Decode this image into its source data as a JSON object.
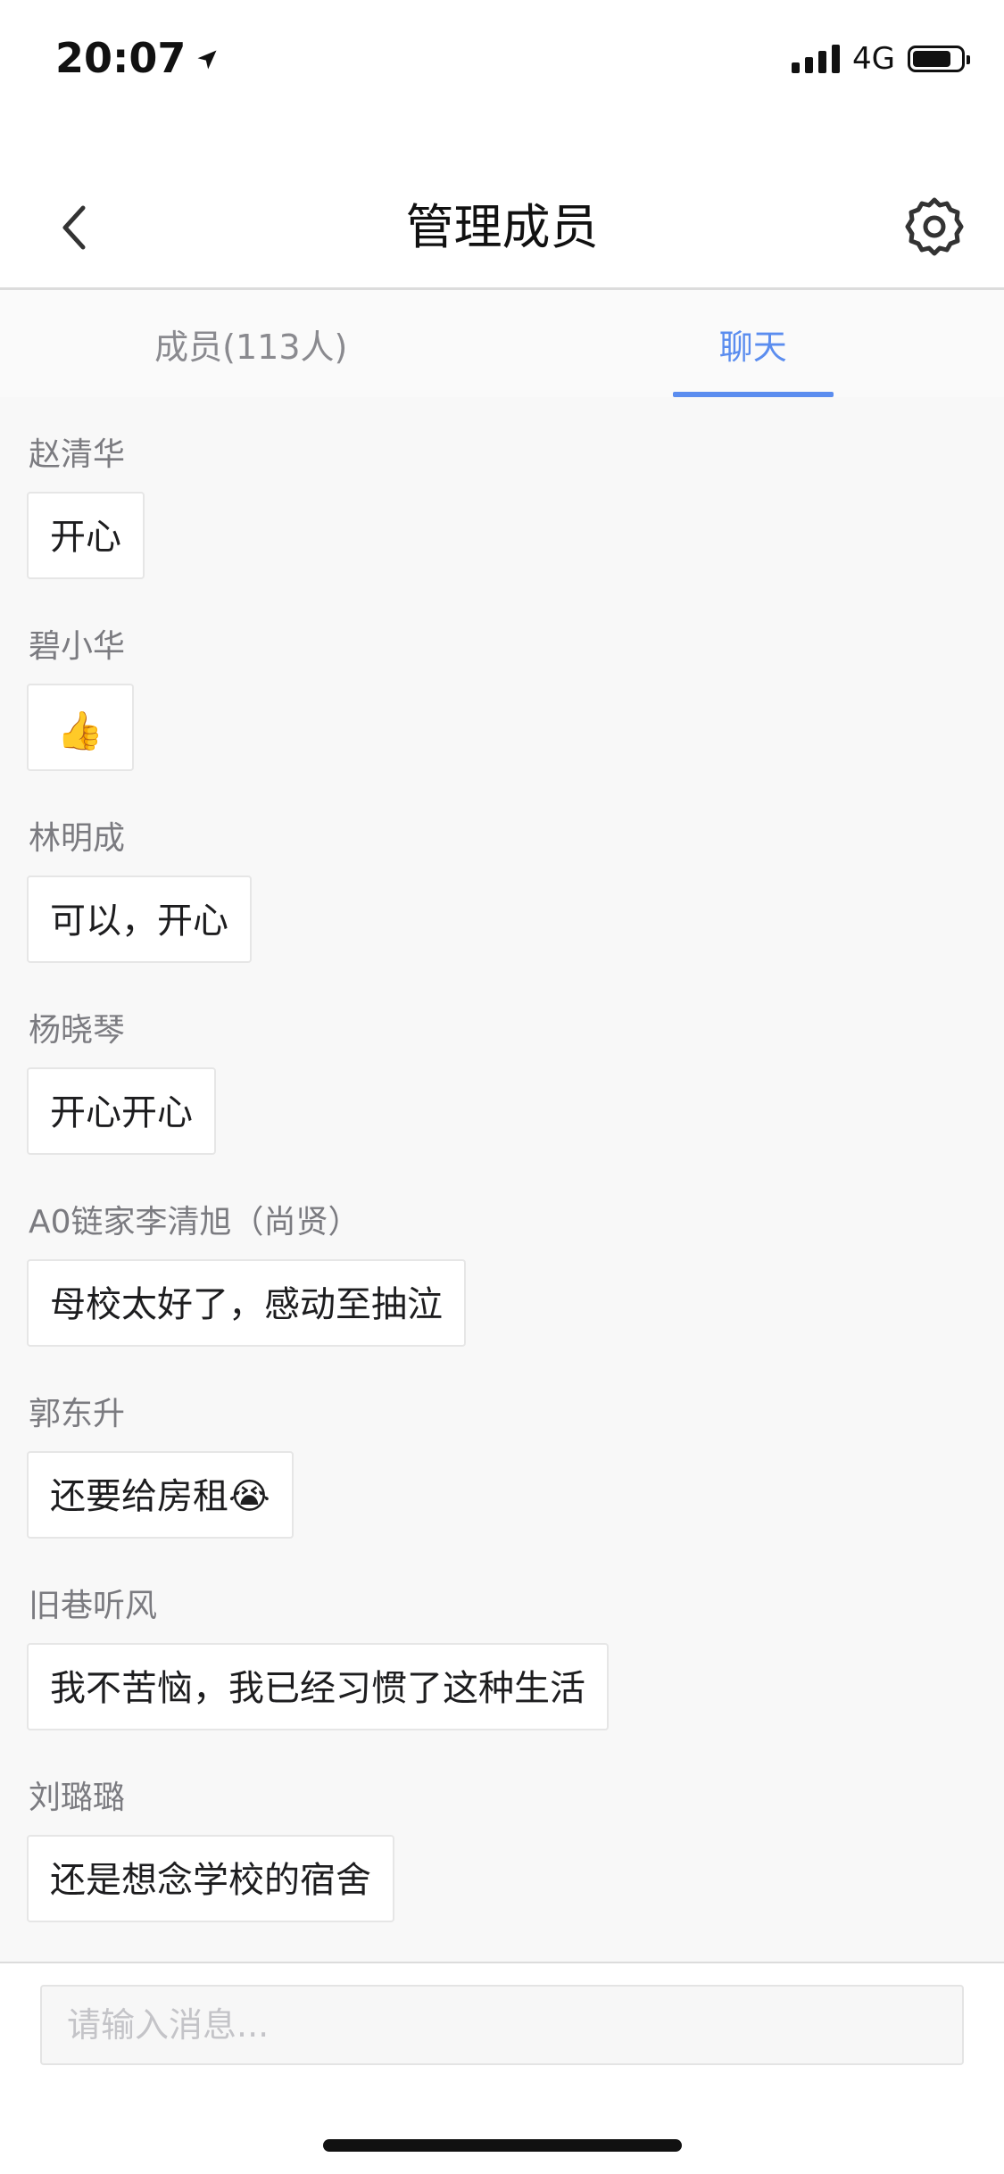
{
  "status_bar": {
    "time": "20:07",
    "location_icon": "location-arrow-icon",
    "network": "4G",
    "battery_level": 0.8
  },
  "nav": {
    "title": "管理成员",
    "back_icon": "chevron-left-icon",
    "settings_icon": "gear-icon"
  },
  "tabs": [
    {
      "label": "成员(113人)",
      "active": false
    },
    {
      "label": "聊天",
      "active": true
    }
  ],
  "accent_color": "#5b8def",
  "messages": [
    {
      "sender": "赵清华",
      "text": "开心"
    },
    {
      "sender": "碧小华",
      "text": "👍"
    },
    {
      "sender": "林明成",
      "text": "可以，开心"
    },
    {
      "sender": "杨晓琴",
      "text": "开心开心"
    },
    {
      "sender": "A0链家李清旭（尚贤）",
      "text": "母校太好了，感动至抽泣"
    },
    {
      "sender": "郭东升",
      "text": "还要给房租😭"
    },
    {
      "sender": "旧巷听风",
      "text": "我不苦恼，我已经习惯了这种生活"
    },
    {
      "sender": "刘璐璐",
      "text": "还是想念学校的宿舍"
    }
  ],
  "input": {
    "placeholder": "请输入消息..."
  }
}
